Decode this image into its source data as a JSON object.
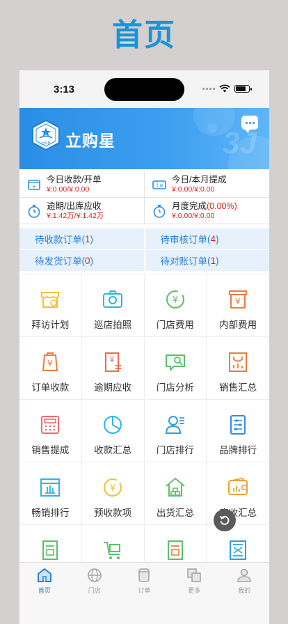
{
  "page_heading": "首页",
  "status_bar": {
    "time": "3:13"
  },
  "header": {
    "app_name": "立购星",
    "logo_caption": "立购星",
    "decoration": "3J"
  },
  "summary": [
    {
      "icon": "wallet-icon",
      "title": "今日收款/开单",
      "value": "¥:0.00/¥:0.00"
    },
    {
      "icon": "ticket-icon",
      "title": "今日/本月提成",
      "value": "¥:0.00/¥:0.00"
    },
    {
      "icon": "stopwatch-icon",
      "title": "逾期/出库应收",
      "value": "¥:1.42万/¥:1.42万"
    },
    {
      "icon": "stopwatch-icon",
      "title": "月度完成",
      "percent": "(0.00%)",
      "value": "¥:0.00/¥:0.00"
    }
  ],
  "orders": [
    {
      "label": "待收款订单",
      "count": "1"
    },
    {
      "label": "待审核订单",
      "count": "4"
    },
    {
      "label": "待发货订单",
      "count": "0"
    },
    {
      "label": "待对账订单",
      "count": "1"
    }
  ],
  "tiles": [
    {
      "label": "拜访计划",
      "icon": "visit-plan-icon",
      "color": "#f2c230"
    },
    {
      "label": "巡店拍照",
      "icon": "camera-icon",
      "color": "#2ab6e6"
    },
    {
      "label": "门店费用",
      "icon": "store-fee-icon",
      "color": "#5cbf6a"
    },
    {
      "label": "内部费用",
      "icon": "internal-fee-icon",
      "color": "#f07a3c"
    },
    {
      "label": "订单收款",
      "icon": "order-payment-icon",
      "color": "#f07a3c"
    },
    {
      "label": "逾期应收",
      "icon": "overdue-receivable-icon",
      "color": "#f06a50"
    },
    {
      "label": "门店分析",
      "icon": "store-analysis-icon",
      "color": "#5cbf6a"
    },
    {
      "label": "销售汇总",
      "icon": "sales-summary-icon",
      "color": "#f07a3c"
    },
    {
      "label": "销售提成",
      "icon": "sales-commission-icon",
      "color": "#f06a70"
    },
    {
      "label": "收款汇总",
      "icon": "pie-chart-icon",
      "color": "#2ab6e6"
    },
    {
      "label": "门店排行",
      "icon": "store-ranking-icon",
      "color": "#2a9ee6"
    },
    {
      "label": "品牌排行",
      "icon": "brand-ranking-icon",
      "color": "#2a8ee4"
    },
    {
      "label": "畅销排行",
      "icon": "bestseller-icon",
      "color": "#2ab6e6"
    },
    {
      "label": "预收款项",
      "icon": "prepayment-icon",
      "color": "#f2c230"
    },
    {
      "label": "出货汇总",
      "icon": "shipment-icon",
      "color": "#5cbf6a"
    },
    {
      "label": "应收汇总",
      "icon": "receivable-summary-icon",
      "color": "#f2a030"
    },
    {
      "label": "",
      "icon": "document-green-icon",
      "color": "#5cbf6a"
    },
    {
      "label": "",
      "icon": "cart-icon",
      "color": "#5cbf6a"
    },
    {
      "label": "",
      "icon": "document-orange-icon",
      "color": "#f07a3c"
    },
    {
      "label": "",
      "icon": "scan-icon",
      "color": "#2a9ee6"
    }
  ],
  "tabbar": [
    {
      "label": "首页",
      "icon": "home-icon",
      "active": true
    },
    {
      "label": "门店",
      "icon": "globe-icon",
      "active": false
    },
    {
      "label": "订单",
      "icon": "order-icon",
      "active": false
    },
    {
      "label": "更多",
      "icon": "more-icon",
      "active": false
    },
    {
      "label": "我的",
      "icon": "profile-icon",
      "active": false
    }
  ],
  "colors": {
    "accent": "#2a8ee4",
    "heading": "#1b93d9",
    "alert": "#e02020",
    "order_text": "#2a7fd4"
  }
}
